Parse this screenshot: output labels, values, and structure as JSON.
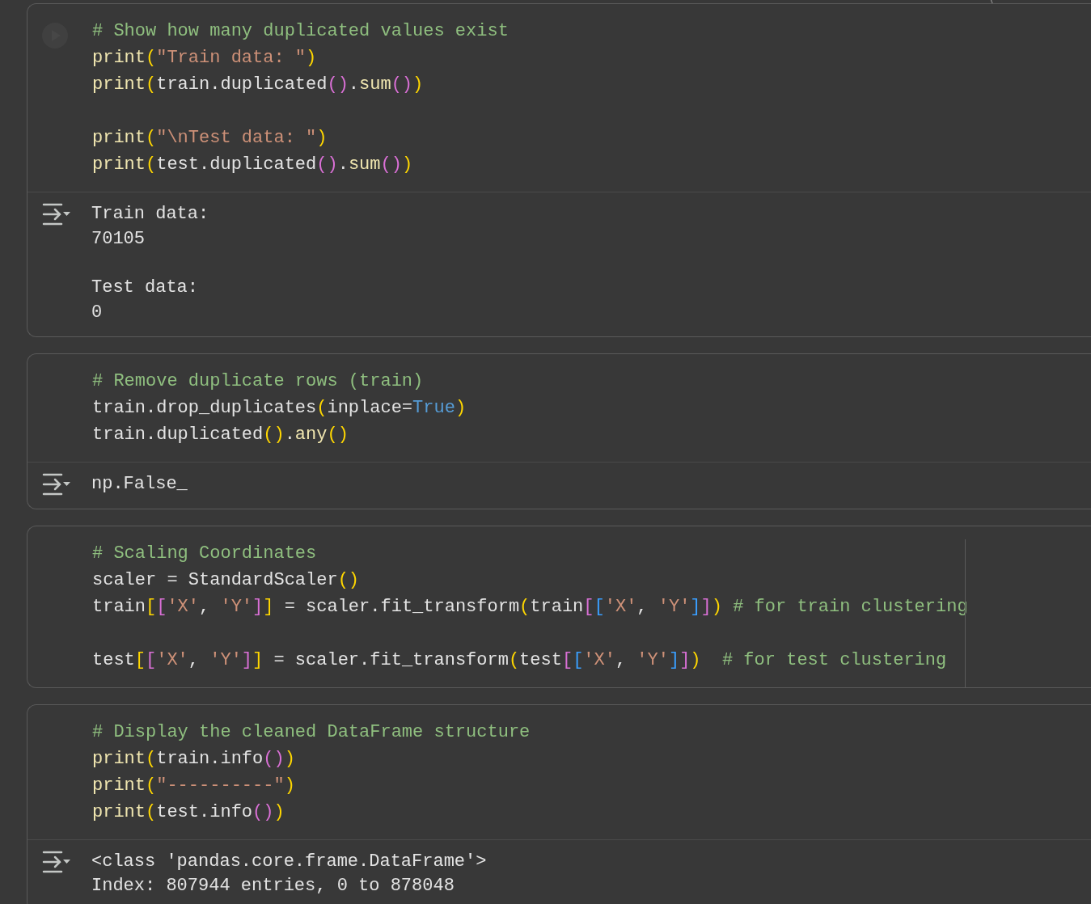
{
  "cells": [
    {
      "run_button_visible": true,
      "code": [
        [
          [
            {
              "kind": "comment",
              "text": "# Show how many duplicated values exist"
            }
          ],
          [
            {
              "kind": "function",
              "text": "print"
            },
            {
              "kind": "bracket1",
              "text": "("
            },
            {
              "kind": "string",
              "text": "\"Train data: \""
            },
            {
              "kind": "bracket1",
              "text": ")"
            }
          ],
          [
            {
              "kind": "function",
              "text": "print"
            },
            {
              "kind": "bracket1",
              "text": "("
            },
            {
              "kind": "plain",
              "text": "train.duplicated"
            },
            {
              "kind": "bracket2",
              "text": "()"
            },
            {
              "kind": "plain",
              "text": "."
            },
            {
              "kind": "function",
              "text": "sum"
            },
            {
              "kind": "bracket2",
              "text": "()"
            },
            {
              "kind": "bracket1",
              "text": ")"
            }
          ]
        ],
        [
          [
            {
              "kind": "function",
              "text": "print"
            },
            {
              "kind": "bracket1",
              "text": "("
            },
            {
              "kind": "string",
              "text": "\"\\nTest data: \""
            },
            {
              "kind": "bracket1",
              "text": ")"
            }
          ],
          [
            {
              "kind": "function",
              "text": "print"
            },
            {
              "kind": "bracket1",
              "text": "("
            },
            {
              "kind": "plain",
              "text": "test.duplicated"
            },
            {
              "kind": "bracket2",
              "text": "()"
            },
            {
              "kind": "plain",
              "text": "."
            },
            {
              "kind": "function",
              "text": "sum"
            },
            {
              "kind": "bracket2",
              "text": "()"
            },
            {
              "kind": "bracket1",
              "text": ")"
            }
          ]
        ]
      ],
      "output": [
        [
          "Train data:",
          "70105"
        ],
        [
          "Test data:",
          "0"
        ]
      ]
    },
    {
      "run_button_visible": false,
      "code": [
        [
          [
            {
              "kind": "comment",
              "text": "# Remove duplicate rows (train)"
            }
          ],
          [
            {
              "kind": "plain",
              "text": "train.drop_duplicates"
            },
            {
              "kind": "bracket1",
              "text": "("
            },
            {
              "kind": "plain",
              "text": "inplace="
            },
            {
              "kind": "keyword",
              "text": "True"
            },
            {
              "kind": "bracket1",
              "text": ")"
            }
          ],
          [
            {
              "kind": "plain",
              "text": "train.duplicated"
            },
            {
              "kind": "bracket1",
              "text": "()"
            },
            {
              "kind": "plain",
              "text": "."
            },
            {
              "kind": "function",
              "text": "any"
            },
            {
              "kind": "bracket1",
              "text": "()"
            }
          ]
        ]
      ],
      "output": [
        [
          "np.False_"
        ]
      ]
    },
    {
      "run_button_visible": false,
      "ruler": true,
      "code": [
        [
          [
            {
              "kind": "comment",
              "text": "# Scaling Coordinates"
            }
          ],
          [
            {
              "kind": "plain",
              "text": "scaler = StandardScaler"
            },
            {
              "kind": "bracket1",
              "text": "()"
            }
          ],
          [
            {
              "kind": "plain",
              "text": "train"
            },
            {
              "kind": "bracket1",
              "text": "["
            },
            {
              "kind": "bracket2",
              "text": "["
            },
            {
              "kind": "string",
              "text": "'X'"
            },
            {
              "kind": "plain",
              "text": ", "
            },
            {
              "kind": "string",
              "text": "'Y'"
            },
            {
              "kind": "bracket2",
              "text": "]"
            },
            {
              "kind": "bracket1",
              "text": "]"
            },
            {
              "kind": "plain",
              "text": " = scaler.fit_transform"
            },
            {
              "kind": "bracket1",
              "text": "("
            },
            {
              "kind": "plain",
              "text": "train"
            },
            {
              "kind": "bracket2",
              "text": "["
            },
            {
              "kind": "bracket3",
              "text": "["
            },
            {
              "kind": "string",
              "text": "'X'"
            },
            {
              "kind": "plain",
              "text": ", "
            },
            {
              "kind": "string",
              "text": "'Y'"
            },
            {
              "kind": "bracket3",
              "text": "]"
            },
            {
              "kind": "bracket2",
              "text": "]"
            },
            {
              "kind": "bracket1",
              "text": ")"
            },
            {
              "kind": "comment",
              "text": " # for train clustering"
            }
          ]
        ],
        [
          [
            {
              "kind": "plain",
              "text": "test"
            },
            {
              "kind": "bracket1",
              "text": "["
            },
            {
              "kind": "bracket2",
              "text": "["
            },
            {
              "kind": "string",
              "text": "'X'"
            },
            {
              "kind": "plain",
              "text": ", "
            },
            {
              "kind": "string",
              "text": "'Y'"
            },
            {
              "kind": "bracket2",
              "text": "]"
            },
            {
              "kind": "bracket1",
              "text": "]"
            },
            {
              "kind": "plain",
              "text": " = scaler.fit_transform"
            },
            {
              "kind": "bracket1",
              "text": "("
            },
            {
              "kind": "plain",
              "text": "test"
            },
            {
              "kind": "bracket2",
              "text": "["
            },
            {
              "kind": "bracket3",
              "text": "["
            },
            {
              "kind": "string",
              "text": "'X'"
            },
            {
              "kind": "plain",
              "text": ", "
            },
            {
              "kind": "string",
              "text": "'Y'"
            },
            {
              "kind": "bracket3",
              "text": "]"
            },
            {
              "kind": "bracket2",
              "text": "]"
            },
            {
              "kind": "bracket1",
              "text": ")"
            },
            {
              "kind": "comment",
              "text": "  # for test clustering"
            }
          ]
        ]
      ]
    },
    {
      "run_button_visible": false,
      "code": [
        [
          [
            {
              "kind": "comment",
              "text": "# Display the cleaned DataFrame structure"
            }
          ],
          [
            {
              "kind": "function",
              "text": "print"
            },
            {
              "kind": "bracket1",
              "text": "("
            },
            {
              "kind": "plain",
              "text": "train.info"
            },
            {
              "kind": "bracket2",
              "text": "()"
            },
            {
              "kind": "bracket1",
              "text": ")"
            }
          ],
          [
            {
              "kind": "function",
              "text": "print"
            },
            {
              "kind": "bracket1",
              "text": "("
            },
            {
              "kind": "string",
              "text": "\"----------\""
            },
            {
              "kind": "bracket1",
              "text": ")"
            }
          ],
          [
            {
              "kind": "function",
              "text": "print"
            },
            {
              "kind": "bracket1",
              "text": "("
            },
            {
              "kind": "plain",
              "text": "test.info"
            },
            {
              "kind": "bracket2",
              "text": "()"
            },
            {
              "kind": "bracket1",
              "text": ")"
            }
          ]
        ]
      ],
      "output": [
        [
          "<class 'pandas.core.frame.DataFrame'>",
          "Index: 807944 entries, 0 to 878048"
        ]
      ]
    }
  ]
}
